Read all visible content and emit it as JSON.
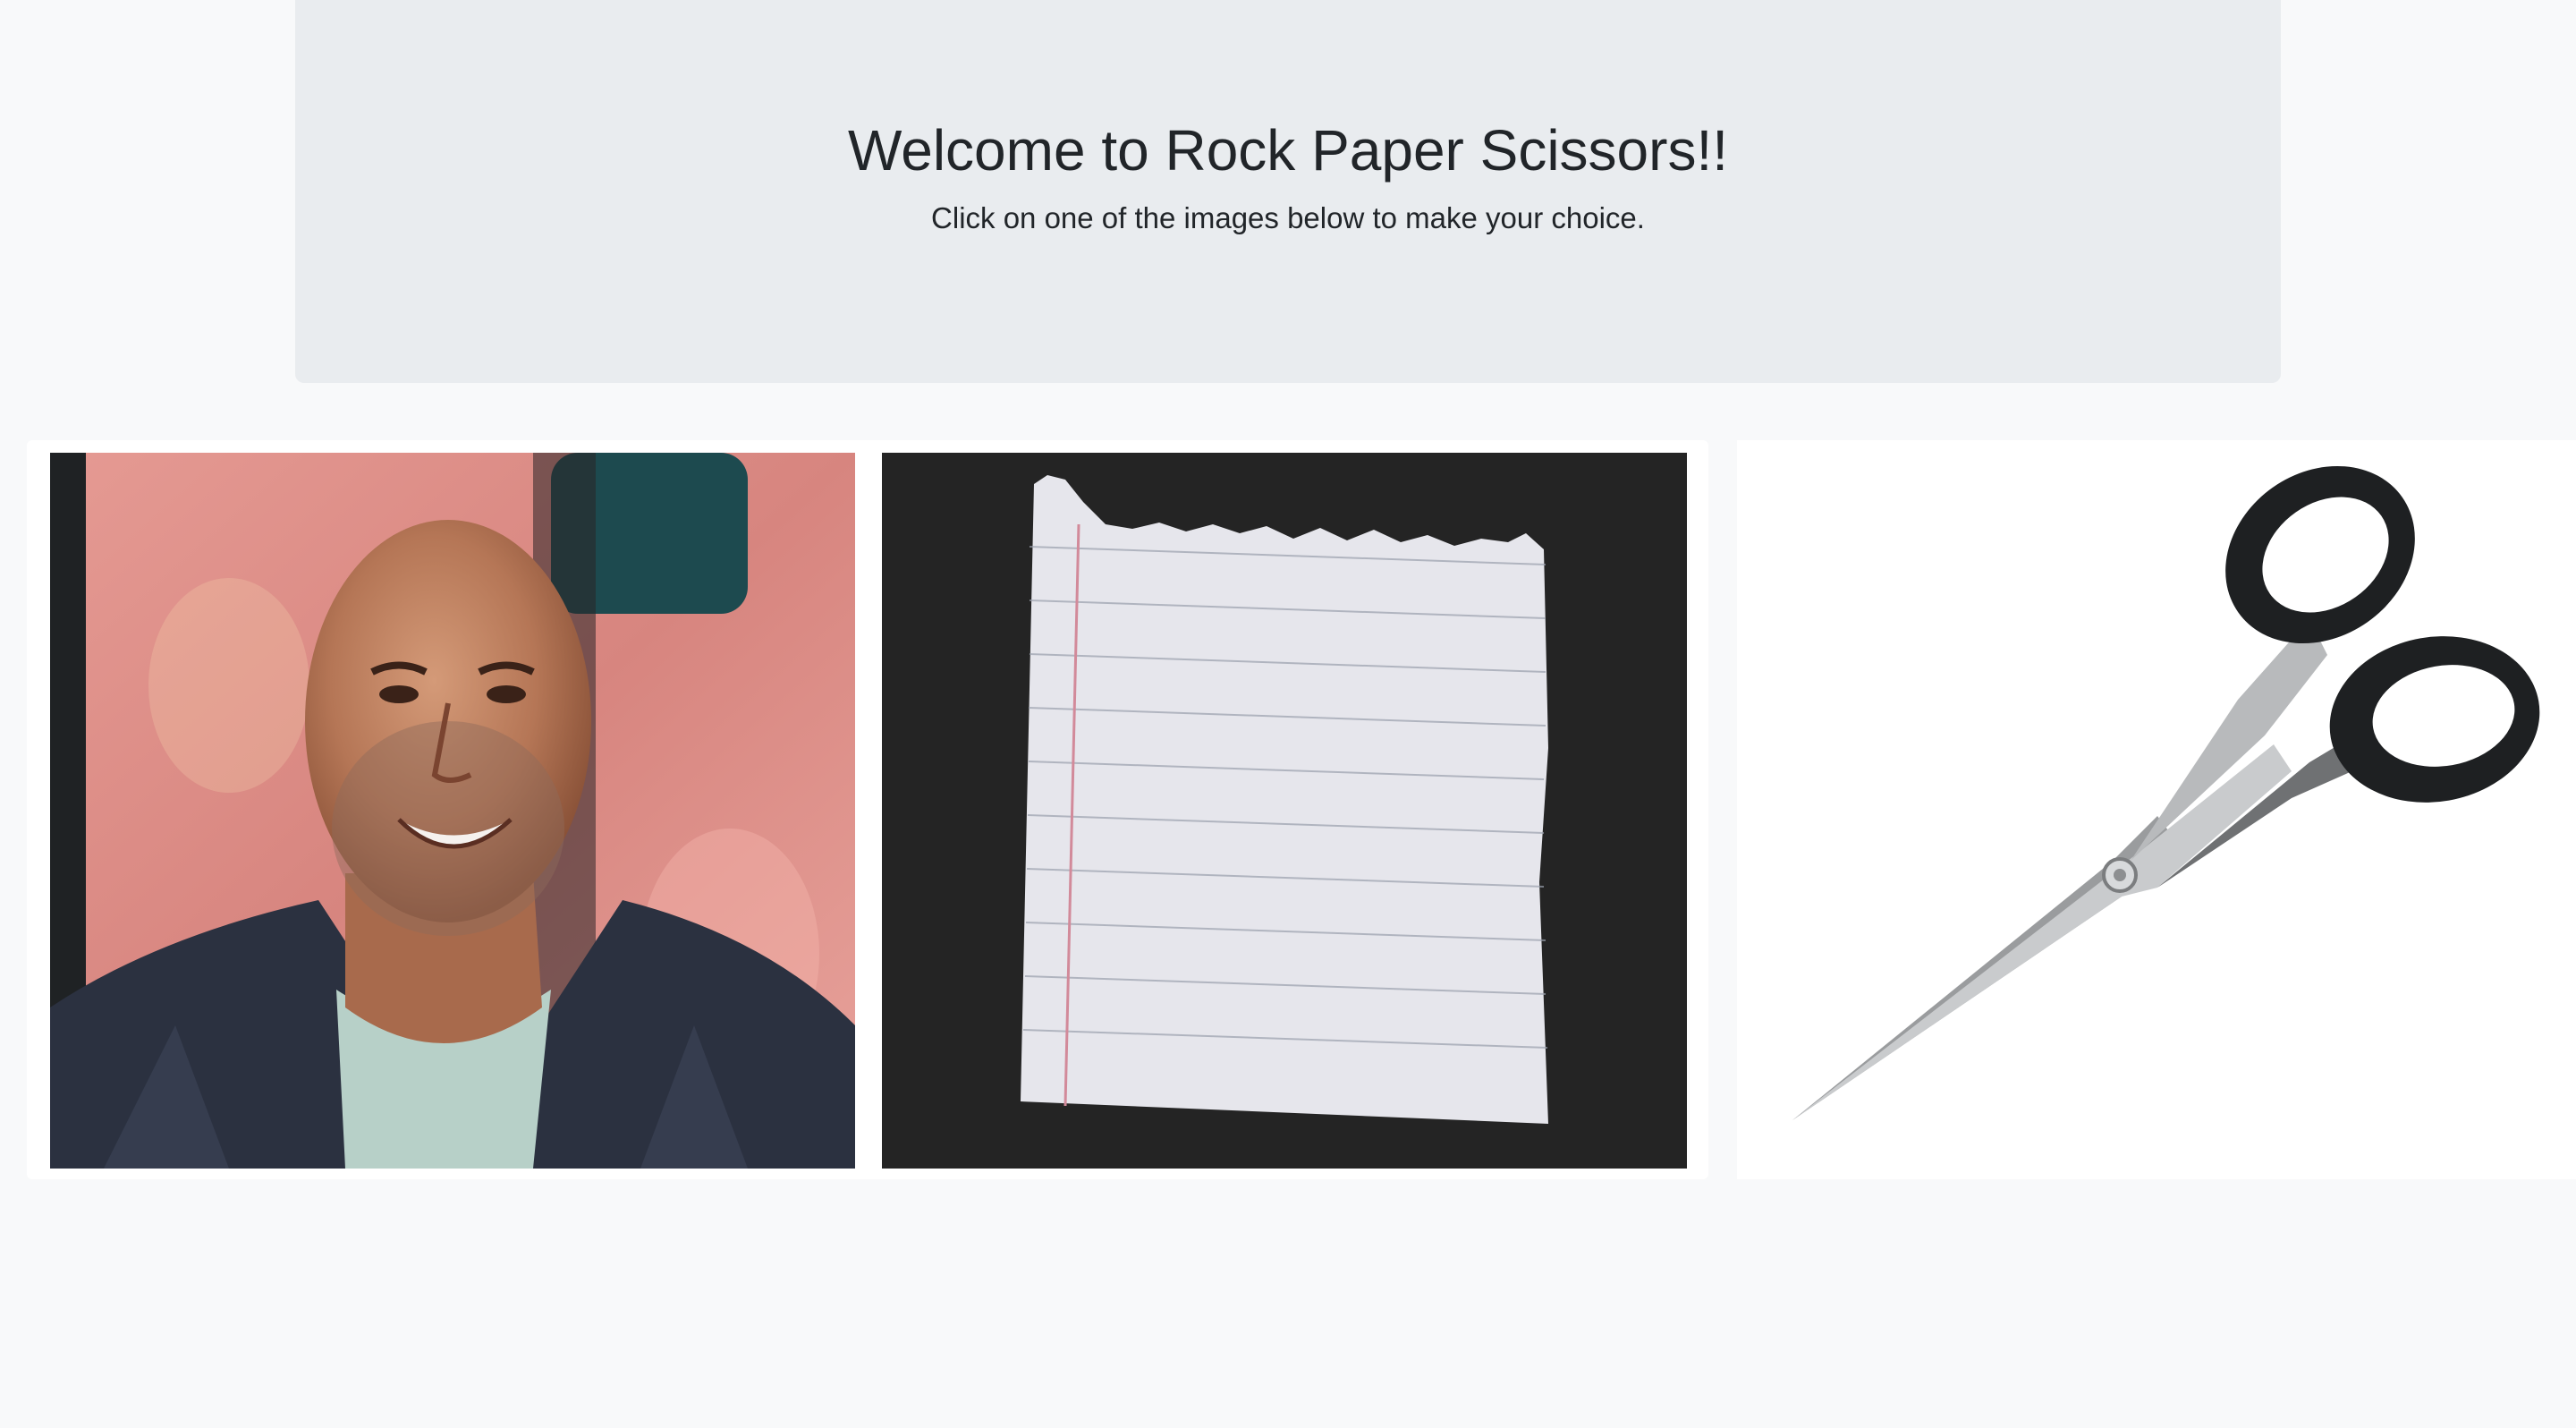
{
  "header": {
    "title": "Welcome to Rock Paper Scissors!!",
    "subtitle": "Click on one of the images below to make your choice."
  },
  "choices": [
    {
      "id": "rock",
      "image": "photo of a smiling bald man (rock)"
    },
    {
      "id": "paper",
      "image": "torn sheet of lined notebook paper"
    },
    {
      "id": "scissors",
      "image": "pair of black-handled scissors"
    }
  ],
  "colors": {
    "page_background": "#f8f9fa",
    "jumbotron_background": "#e9ecef",
    "card_background": "#ffffff",
    "text": "#212529"
  }
}
